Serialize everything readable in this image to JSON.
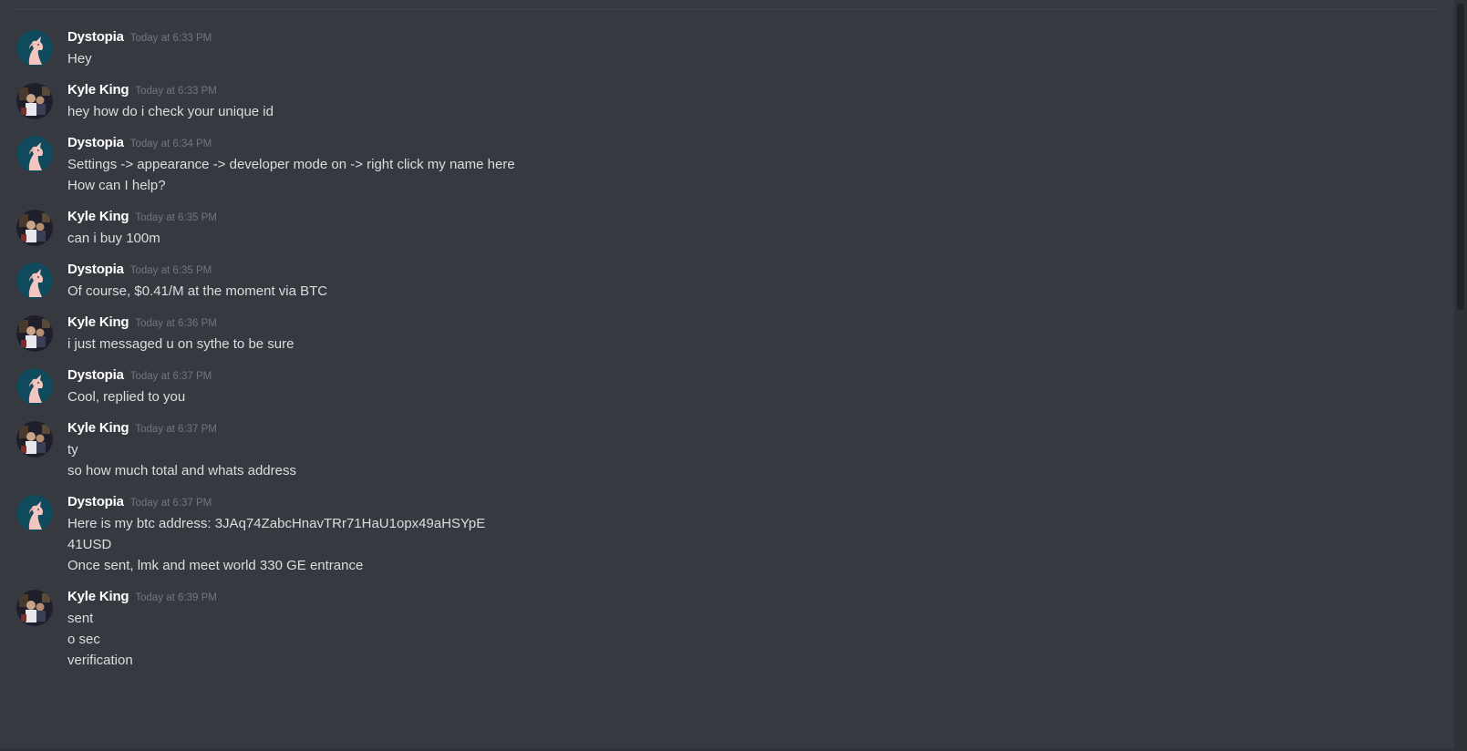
{
  "messages": [
    {
      "author": "Dystopia",
      "avatar": "unicorn-avatar",
      "timestamp": "Today at 6:33 PM",
      "lines": [
        "Hey"
      ]
    },
    {
      "author": "Kyle King",
      "avatar": "photo-avatar",
      "timestamp": "Today at 6:33 PM",
      "lines": [
        "hey how do i check your unique id"
      ]
    },
    {
      "author": "Dystopia",
      "avatar": "unicorn-avatar",
      "timestamp": "Today at 6:34 PM",
      "lines": [
        "Settings -> appearance -> developer mode on -> right click my name here",
        "How can I help?"
      ]
    },
    {
      "author": "Kyle King",
      "avatar": "photo-avatar",
      "timestamp": "Today at 6:35 PM",
      "lines": [
        "can i buy 100m"
      ]
    },
    {
      "author": "Dystopia",
      "avatar": "unicorn-avatar",
      "timestamp": "Today at 6:35 PM",
      "lines": [
        "Of course, $0.41/M at the moment via BTC"
      ]
    },
    {
      "author": "Kyle King",
      "avatar": "photo-avatar",
      "timestamp": "Today at 6:36 PM",
      "lines": [
        "i just messaged u on sythe to be sure"
      ]
    },
    {
      "author": "Dystopia",
      "avatar": "unicorn-avatar",
      "timestamp": "Today at 6:37 PM",
      "lines": [
        "Cool, replied to you"
      ]
    },
    {
      "author": "Kyle King",
      "avatar": "photo-avatar",
      "timestamp": "Today at 6:37 PM",
      "lines": [
        "ty",
        "so how much total and whats address"
      ]
    },
    {
      "author": "Dystopia",
      "avatar": "unicorn-avatar",
      "timestamp": "Today at 6:37 PM",
      "lines": [
        "Here is my btc address: 3JAq74ZabcHnavTRr71HaU1opx49aHSYpE",
        "41USD",
        "Once sent, lmk and meet world 330 GE entrance"
      ]
    },
    {
      "author": "Kyle King",
      "avatar": "photo-avatar",
      "timestamp": "Today at 6:39 PM",
      "lines": [
        "sent",
        "o sec",
        "verification"
      ]
    }
  ],
  "colors": {
    "background": "#36393f",
    "username": "#ffffff",
    "timestamp": "#72767d",
    "message_text": "#dcddde",
    "unicorn_avatar_bg": "#0f4b5c",
    "unicorn_color": "#f3c5c0"
  }
}
